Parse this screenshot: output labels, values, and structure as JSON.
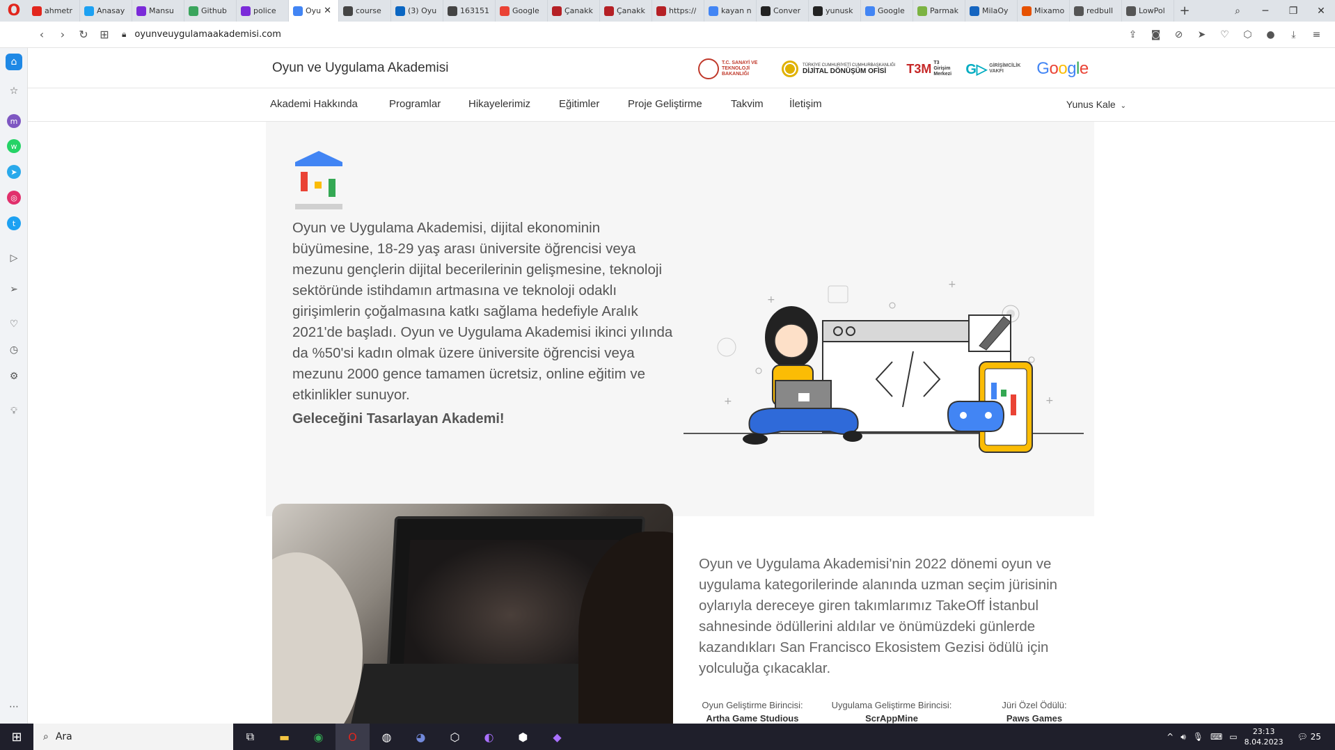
{
  "browser": {
    "tabs": [
      {
        "title": "ahmetr",
        "color": "#e2261d"
      },
      {
        "title": "Anasay",
        "color": "#1da1f2"
      },
      {
        "title": "Mansu",
        "color": "#7b2bd9"
      },
      {
        "title": "Github",
        "color": "#3ba55d"
      },
      {
        "title": "police",
        "color": "#7b2bd9"
      },
      {
        "title": "Oyu",
        "color": "#4285f4",
        "active": true
      },
      {
        "title": "course",
        "color": "#444"
      },
      {
        "title": "(3) Oyu",
        "color": "#0a66c2"
      },
      {
        "title": "163151",
        "color": "#444"
      },
      {
        "title": "Google",
        "color": "#ea4335"
      },
      {
        "title": "Çanakk",
        "color": "#b52025"
      },
      {
        "title": "Çanakk",
        "color": "#b52025"
      },
      {
        "title": "https://",
        "color": "#b52025"
      },
      {
        "title": "kayan n",
        "color": "#4285f4"
      },
      {
        "title": "Conver",
        "color": "#222"
      },
      {
        "title": "yunusk",
        "color": "#222"
      },
      {
        "title": "Google",
        "color": "#4285f4"
      },
      {
        "title": "Parmak",
        "color": "#7cb342"
      },
      {
        "title": "MilaOy",
        "color": "#1565c0"
      },
      {
        "title": "Mixamo",
        "color": "#e65100"
      },
      {
        "title": "redbull",
        "color": "#555"
      },
      {
        "title": "LowPol",
        "color": "#555"
      }
    ],
    "url": "oyunveuygulamaakademisi.com"
  },
  "site": {
    "title": "Oyun ve Uygulama Akademisi",
    "partners": {
      "ministry": "T.C. SANAYİ VE TEKNOLOJİ BAKANLIĞI",
      "office_top": "TÜRKİYE CUMHURİYETİ CUMHURBAŞKANLIĞI",
      "office": "DİJİTAL DÖNÜŞÜM OFİSİ",
      "t3": "T3 Girişim Merkezi",
      "vakfi": "GİRİŞİMCİLİK VAKFI",
      "google": "Google"
    },
    "nav": [
      "Akademi Hakkında",
      "Programlar",
      "Hikayelerimiz",
      "Eğitimler",
      "Proje Geliştirme",
      "Takvim",
      "İletişim"
    ],
    "user": "Yunus Kale"
  },
  "hero": {
    "text": "Oyun ve Uygulama Akademisi, dijital ekonominin büyümesine, 18-29 yaş arası üniversite öğrencisi veya mezunu gençlerin dijital becerilerinin gelişmesine, teknoloji sektöründe istihdamın artmasına ve teknoloji odaklı girişimlerin çoğalmasına katkı sağlama hedefiyle Aralık 2021'de başladı. Oyun ve Uygulama Akademisi ikinci yılında da %50'si kadın olmak üzere üniversite öğrencisi veya mezunu 2000 gence tamamen ücretsiz, online eğitim ve etkinlikler sunuyor.",
    "tagline": "Geleceğini Tasarlayan Akademi!"
  },
  "story": {
    "text": "Oyun ve Uygulama Akademisi'nin 2022 dönemi oyun ve uygulama kategorilerinde alanında uzman seçim jürisinin oylarıyla dereceye giren takımlarımız TakeOff İstanbul sahnesinde ödüllerini aldılar ve önümüzdeki günlerde kazandıkları San Francisco Ekosistem Gezisi ödülü için yolculuğa çıkacaklar.",
    "winners": [
      {
        "label": "Oyun Geliştirme Birincisi:",
        "name": "Artha Game Studious"
      },
      {
        "label": "Uygulama Geliştirme Birincisi:",
        "name": "ScrAppMine"
      },
      {
        "label": "Jüri Özel Ödülü:",
        "name": "Paws Games"
      }
    ]
  },
  "taskbar": {
    "search": "Ara",
    "time": "23:13",
    "date": "8.04.2023",
    "notifications": "25"
  }
}
